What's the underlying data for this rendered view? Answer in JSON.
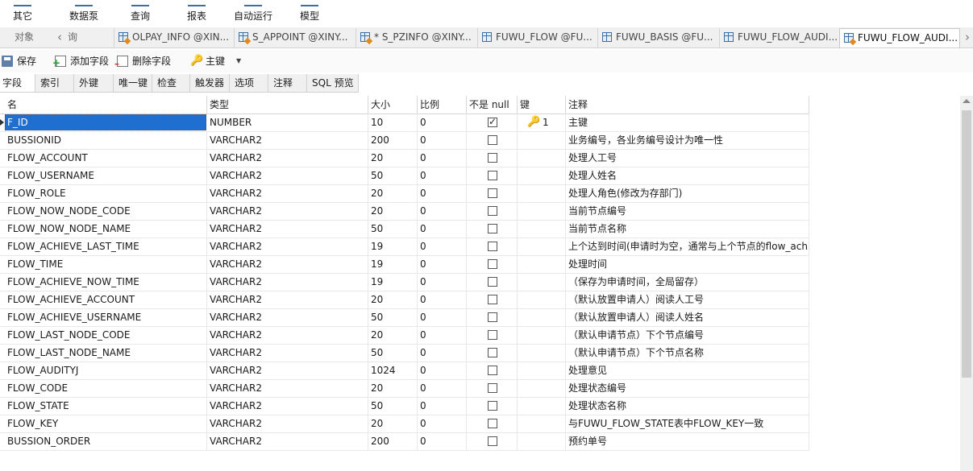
{
  "ribbon": {
    "items": [
      {
        "label": "其它"
      },
      {
        "label": "数据泵"
      },
      {
        "label": "查询"
      },
      {
        "label": "报表"
      },
      {
        "label": "自动运行"
      },
      {
        "label": "模型"
      }
    ]
  },
  "tabstrip": {
    "object_label": "对象",
    "query_label": "询",
    "tabs": [
      {
        "label": "OLPAY_INFO @XIN..."
      },
      {
        "label": "S_APPOINT @XINY..."
      },
      {
        "label": "* S_PZINFO @XINY..."
      },
      {
        "label": "FUWU_FLOW @FU..."
      },
      {
        "label": "FUWU_BASIS @FU..."
      },
      {
        "label": "FUWU_FLOW_AUDI..."
      },
      {
        "label": "FUWU_FLOW_AUDI..."
      }
    ],
    "active_tab": 6
  },
  "toolbar": {
    "save": "保存",
    "add_field": "添加字段",
    "delete_field": "删除字段",
    "primary_key": "主键"
  },
  "subtabs": [
    "字段",
    "索引",
    "外键",
    "唯一键",
    "检查",
    "触发器",
    "选项",
    "注释",
    "SQL 预览"
  ],
  "grid": {
    "headers": {
      "name": "名",
      "type": "类型",
      "size": "大小",
      "scale": "比例",
      "not_null": "不是 null",
      "key": "键",
      "comment": "注释"
    },
    "rows": [
      {
        "name": "F_ID",
        "type": "NUMBER",
        "size": "10",
        "scale": "0",
        "not_null": true,
        "key": "1",
        "comment": "主键"
      },
      {
        "name": "BUSSIONID",
        "type": "VARCHAR2",
        "size": "200",
        "scale": "0",
        "not_null": false,
        "key": "",
        "comment": "业务编号，各业务编号设计为唯一性"
      },
      {
        "name": "FLOW_ACCOUNT",
        "type": "VARCHAR2",
        "size": "20",
        "scale": "0",
        "not_null": false,
        "key": "",
        "comment": "处理人工号"
      },
      {
        "name": "FLOW_USERNAME",
        "type": "VARCHAR2",
        "size": "50",
        "scale": "0",
        "not_null": false,
        "key": "",
        "comment": "处理人姓名"
      },
      {
        "name": "FLOW_ROLE",
        "type": "VARCHAR2",
        "size": "20",
        "scale": "0",
        "not_null": false,
        "key": "",
        "comment": "处理人角色(修改为存部门)"
      },
      {
        "name": "FLOW_NOW_NODE_CODE",
        "type": "VARCHAR2",
        "size": "20",
        "scale": "0",
        "not_null": false,
        "key": "",
        "comment": "当前节点编号"
      },
      {
        "name": "FLOW_NOW_NODE_NAME",
        "type": "VARCHAR2",
        "size": "50",
        "scale": "0",
        "not_null": false,
        "key": "",
        "comment": "当前节点名称"
      },
      {
        "name": "FLOW_ACHIEVE_LAST_TIME",
        "type": "VARCHAR2",
        "size": "19",
        "scale": "0",
        "not_null": false,
        "key": "",
        "comment": "上个达到时间(申请时为空，通常与上个节点的flow_achi"
      },
      {
        "name": "FLOW_TIME",
        "type": "VARCHAR2",
        "size": "19",
        "scale": "0",
        "not_null": false,
        "key": "",
        "comment": "处理时间"
      },
      {
        "name": "FLOW_ACHIEVE_NOW_TIME",
        "type": "VARCHAR2",
        "size": "19",
        "scale": "0",
        "not_null": false,
        "key": "",
        "comment": "（保存为申请时间，全局留存）"
      },
      {
        "name": "FLOW_ACHIEVE_ACCOUNT",
        "type": "VARCHAR2",
        "size": "20",
        "scale": "0",
        "not_null": false,
        "key": "",
        "comment": "（默认放置申请人）阅读人工号"
      },
      {
        "name": "FLOW_ACHIEVE_USERNAME",
        "type": "VARCHAR2",
        "size": "50",
        "scale": "0",
        "not_null": false,
        "key": "",
        "comment": "（默认放置申请人）阅读人姓名"
      },
      {
        "name": "FLOW_LAST_NODE_CODE",
        "type": "VARCHAR2",
        "size": "20",
        "scale": "0",
        "not_null": false,
        "key": "",
        "comment": "（默认申请节点）下个节点编号"
      },
      {
        "name": "FLOW_LAST_NODE_NAME",
        "type": "VARCHAR2",
        "size": "50",
        "scale": "0",
        "not_null": false,
        "key": "",
        "comment": "（默认申请节点）下个节点名称"
      },
      {
        "name": "FLOW_AUDITYJ",
        "type": "VARCHAR2",
        "size": "1024",
        "scale": "0",
        "not_null": false,
        "key": "",
        "comment": "处理意见"
      },
      {
        "name": "FLOW_CODE",
        "type": "VARCHAR2",
        "size": "20",
        "scale": "0",
        "not_null": false,
        "key": "",
        "comment": "处理状态编号"
      },
      {
        "name": "FLOW_STATE",
        "type": "VARCHAR2",
        "size": "50",
        "scale": "0",
        "not_null": false,
        "key": "",
        "comment": "处理状态名称"
      },
      {
        "name": "FLOW_KEY",
        "type": "VARCHAR2",
        "size": "20",
        "scale": "0",
        "not_null": false,
        "key": "",
        "comment": "与FUWU_FLOW_STATE表中FLOW_KEY一致"
      },
      {
        "name": "BUSSION_ORDER",
        "type": "VARCHAR2",
        "size": "200",
        "scale": "0",
        "not_null": false,
        "key": "",
        "comment": "预约单号"
      }
    ]
  }
}
